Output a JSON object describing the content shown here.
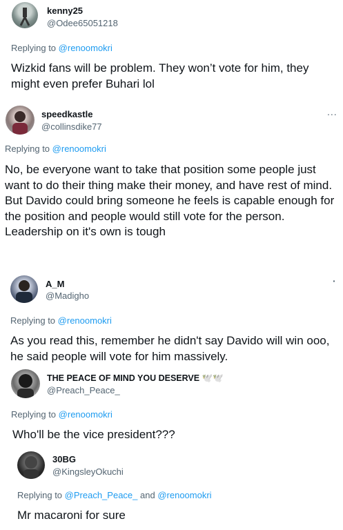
{
  "tweets": [
    {
      "username": "kenny25",
      "handle": "@Odee65051218",
      "replying_prefix": "Replying to",
      "replying_to": [
        "@renoomokri"
      ],
      "text": "Wizkid fans will be problem. They won’t vote for him, they might even prefer Buhari lol"
    },
    {
      "username": "speedkastle",
      "handle": "@collinsdike77",
      "replying_prefix": "Replying to",
      "replying_to": [
        "@renoomokri"
      ],
      "text": "No, be everyone want to take that position some people just want to do their thing make their money, and have rest of mind. But Davido could bring someone he feels is capable enough for the position and people would still vote for the person. Leadership on it's own is tough",
      "more_icon": "..."
    },
    {
      "username": "A_M",
      "handle": "@Madigho",
      "replying_prefix": "Replying to",
      "replying_to": [
        "@renoomokri"
      ],
      "text": "As you read this, remember he didn't say Davido will win ooo, he said people will vote for him massively.",
      "more_icon": "·"
    },
    {
      "username": "THE PEACE OF MIND YOU DESERVE 🕊️🕊️",
      "handle": "@Preach_Peace_",
      "replying_prefix": "Replying to",
      "replying_to": [
        "@renoomokri"
      ],
      "text": "Who'll be the vice president???"
    },
    {
      "username": "30BG",
      "handle": "@KingsleyOkuchi",
      "replying_prefix": "Replying to",
      "replying_to": [
        "@Preach_Peace_",
        "@renoomokri"
      ],
      "replying_joiner": "and",
      "text": "Mr macaroni for sure"
    }
  ],
  "colors": {
    "link": "#1d9bf0",
    "secondary_text": "#536471",
    "primary_text": "#0f1419"
  }
}
